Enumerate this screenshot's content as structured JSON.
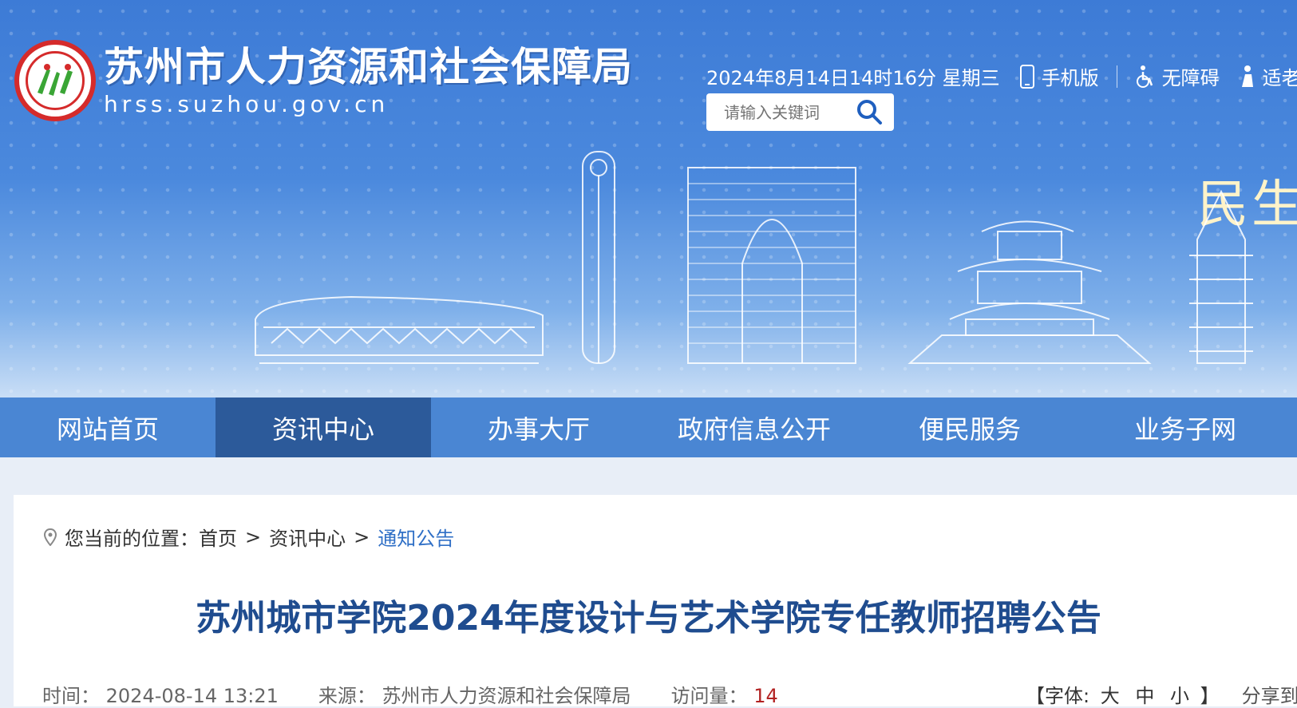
{
  "header": {
    "site_title": "苏州市人力资源和社会保障局",
    "site_domain": "hrss.suzhou.gov.cn",
    "datetime": "2024年8月14日14时16分 星期三",
    "mobile_label": "手机版",
    "accessibility_label": "无障碍",
    "elderly_label": "适老",
    "search_placeholder": "请输入关键词",
    "slogan": "民生"
  },
  "nav": {
    "items": [
      {
        "label": "网站首页"
      },
      {
        "label": "资讯中心"
      },
      {
        "label": "办事大厅"
      },
      {
        "label": "政府信息公开"
      },
      {
        "label": "便民服务"
      },
      {
        "label": "业务子网"
      }
    ]
  },
  "breadcrumb": {
    "prefix": "您当前的位置：",
    "home": "首页",
    "sep": ">",
    "section": "资讯中心",
    "current": "通知公告"
  },
  "article": {
    "title": "苏州城市学院2024年度设计与艺术学院专任教师招聘公告",
    "time_label": "时间：",
    "time_value": "2024-08-14 13:21",
    "source_label": "来源：",
    "source_value": "苏州市人力资源和社会保障局",
    "hits_label": "访问量：",
    "hits_value": "14",
    "font_open": "【字体:",
    "font_large": "大",
    "font_medium": "中",
    "font_small": "小",
    "font_close": "】",
    "share_label": "分享到："
  },
  "colors": {
    "nav_bg": "#4a86d3",
    "nav_active": "#2c5a9a",
    "title_color": "#1f4c8f",
    "crumb_current": "#2f6fc6",
    "hits_color": "#b22222",
    "logo_red": "#d52b2b",
    "logo_green": "#3aa535"
  }
}
